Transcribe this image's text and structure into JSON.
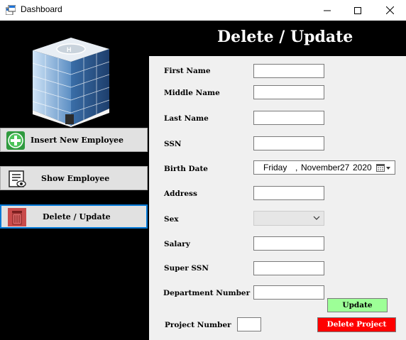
{
  "window": {
    "title": "Dashboard"
  },
  "sidebar": {
    "items": [
      {
        "label": "Insert New Employee",
        "icon": "plus-icon"
      },
      {
        "label": "Show Employee",
        "icon": "view-list-icon"
      },
      {
        "label": "Delete / Update",
        "icon": "trash-icon",
        "active": true
      }
    ]
  },
  "header": {
    "title": "Delete / Update"
  },
  "form": {
    "first_name_label": "First Name",
    "middle_name_label": "Middle Name",
    "last_name_label": "Last Name",
    "ssn_label": "SSN",
    "birth_date_label": "Birth Date",
    "birth_date": {
      "weekday": "Friday",
      "month": "November",
      "day": "27",
      "year": "2020"
    },
    "address_label": "Address",
    "sex_label": "Sex",
    "salary_label": "Salary",
    "super_ssn_label": "Super SSN",
    "department_number_label": "Department Number",
    "project_number_label": "Project Number",
    "update_label": "Update",
    "delete_project_label": "Delete Project"
  },
  "colors": {
    "update_button": "#9dff97",
    "delete_button": "#ff0000",
    "active_border": "#0078d7"
  }
}
